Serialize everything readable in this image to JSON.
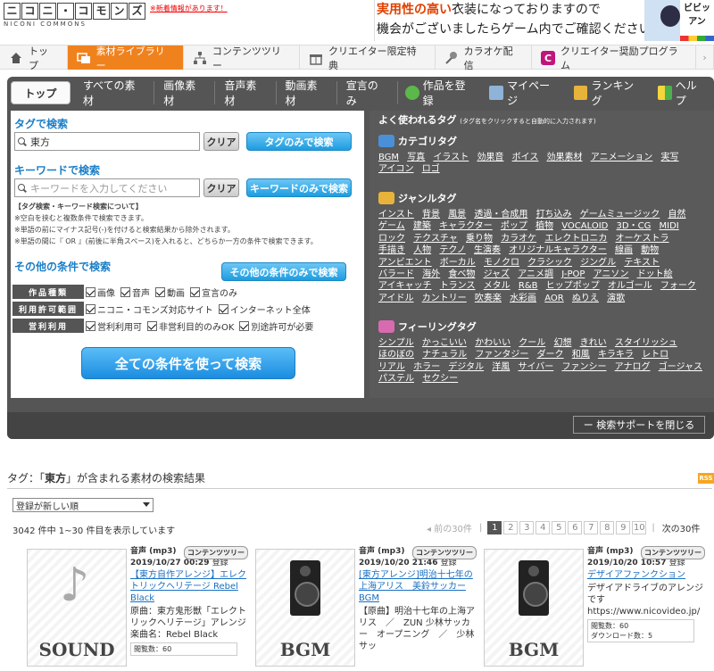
{
  "header": {
    "logo_chars": [
      "ニ",
      "コ",
      "ニ",
      "・",
      "コ",
      "モ",
      "ン",
      "ズ"
    ],
    "logo_sub": "NICONI COMMONS",
    "news": "※新着情報があります！",
    "banner_line1a": "実用性の高い",
    "banner_line1b": "衣装になっておりますので",
    "banner_line2": "機会がございましたらゲーム内でご確認ください。",
    "banner_brand": "ビビッ アン"
  },
  "nav": [
    {
      "label": "トップ",
      "icon": "home-icon"
    },
    {
      "label": "素材ライブラリー",
      "icon": "library-icon"
    },
    {
      "label": "コンテンツツリー",
      "icon": "tree-icon"
    },
    {
      "label": "クリエイター限定特典",
      "icon": "gift-icon"
    },
    {
      "label": "カラオケ配信",
      "icon": "microphone-icon"
    },
    {
      "label": "クリエイター奨励プログラム",
      "icon": "c-icon"
    }
  ],
  "tabs": [
    "すべての素材",
    "画像素材",
    "音声素材",
    "動画素材",
    "宣言のみ"
  ],
  "tab_top": "トップ",
  "tabs_right": [
    "作品を登録",
    "マイページ",
    "ランキング",
    "ヘルプ"
  ],
  "search": {
    "tag_title": "タグで検索",
    "tag_value": "東方",
    "clear": "クリア",
    "tag_only": "タグのみで検索",
    "kw_title": "キーワードで検索",
    "kw_placeholder": "キーワードを入力してください",
    "kw_only": "キーワードのみで検索",
    "note_title": "【タグ検索・キーワード検索について】",
    "note1": "※空白を挟むと複数条件で検索できます。",
    "note2": "※単語の前にマイナス記号(-)を付けると検索結果から除外されます。",
    "note3": "※単語の間に『 OR 』(前後に半角スペース)を入れると、どちらか一方の条件で検索できます。",
    "other_title": "その他の条件で検索",
    "other_only": "その他の条件のみで検索",
    "rows": [
      {
        "label": "作品種類",
        "opts": [
          "画像",
          "音声",
          "動画",
          "宣言のみ"
        ]
      },
      {
        "label": "利用許可範囲",
        "opts": [
          "ニコニ・コモンズ対応サイト",
          "インターネット全体"
        ]
      },
      {
        "label": "営利利用",
        "opts": [
          "営利利用可",
          "非営利目的のみOK",
          "別途許可が必要"
        ]
      }
    ],
    "all_search": "全ての条件を使って検索"
  },
  "tags": {
    "title": "よく使われるタグ",
    "title_note": "(タグ名をクリックすると自動的に入力されます)",
    "cat_head": "カテゴリタグ",
    "cat": [
      "BGM",
      "写真",
      "イラスト",
      "効果音",
      "ボイス",
      "効果素材",
      "アニメーション",
      "実写",
      "アイコン",
      "ロゴ"
    ],
    "genre_head": "ジャンルタグ",
    "genre": [
      "インスト",
      "背景",
      "風景",
      "透過・合成用",
      "打ち込み",
      "ゲームミュージック",
      "自然",
      "ゲーム",
      "建築",
      "キャラクター",
      "ポップ",
      "植物",
      "VOCALOID",
      "3D・CG",
      "MIDI",
      "ロック",
      "テクスチャ",
      "乗り物",
      "カラオケ",
      "エレクトロニカ",
      "オーケストラ",
      "手描き",
      "人物",
      "テクノ",
      "生演奏",
      "オリジナルキャラクター",
      "線画",
      "動物",
      "アンビエント",
      "ボーカル",
      "モノクロ",
      "クラシック",
      "ジングル",
      "テキスト",
      "バラード",
      "海外",
      "食べ物",
      "ジャズ",
      "アニメ調",
      "J-POP",
      "アニソン",
      "ドット絵",
      "アイキャッチ",
      "トランス",
      "メタル",
      "R&B",
      "ヒップポップ",
      "オルゴール",
      "フォーク",
      "アイドル",
      "カントリー",
      "吹奏楽",
      "水彩画",
      "AOR",
      "ぬりえ",
      "演歌"
    ],
    "feel_head": "フィーリングタグ",
    "feel": [
      "シンプル",
      "かっこいい",
      "かわいい",
      "クール",
      "幻想",
      "きれい",
      "スタイリッシュ",
      "ほのぼの",
      "ナチュラル",
      "ファンタジー",
      "ダーク",
      "和風",
      "キラキラ",
      "レトロ",
      "リアル",
      "ホラー",
      "デジタル",
      "洋風",
      "サイバー",
      "ファンシー",
      "アナログ",
      "ゴージャス",
      "パステル",
      "セクシー"
    ]
  },
  "close_support": "ー 検索サポートを閉じる",
  "results": {
    "title_pre": "タグ：「",
    "title_tag": "東方",
    "title_post": "」が含まれる素材の検索結果",
    "rss": "RSS",
    "sort": "登録が新しい順",
    "count": "3042 件中 1~30 件目を表示しています",
    "prev": "◂ 前の30件",
    "pages": [
      "1",
      "2",
      "3",
      "4",
      "5",
      "6",
      "7",
      "8",
      "9",
      "10"
    ],
    "next": "次の30件",
    "cards": [
      {
        "thumb": "SOUND",
        "type": "音声 (mp3)",
        "badge": "コンテンツツリー",
        "date": "2019/10/27 00:29",
        "reg": "登録",
        "title": "【東方自作アレンジ】エレクトリックヘリテージ Rebel Black",
        "desc": "原曲：東方鬼形獣「エレクトリックヘリテージ」アレンジ楽曲名：Rebel Black",
        "stats": "閲覧数：60",
        "dl": ""
      },
      {
        "thumb": "BGM",
        "type": "音声 (mp3)",
        "badge": "コンテンツツリー",
        "date": "2019/10/20 21:46",
        "reg": "登録",
        "title": "[東方アレンジ]明治十七年の上海アリス　美鈴サッカー BGM",
        "desc": "【原曲】明治十七年の上海アリス　／　ZUN 少林サッカー　オープニング　／　少林サッ",
        "stats": "",
        "dl": ""
      },
      {
        "thumb": "BGM",
        "type": "音声 (mp3)",
        "badge": "コンテンツツリー",
        "date": "2019/10/20 10:57",
        "reg": "登録",
        "title": "デザイアファンクション",
        "desc": "デザイアドライブのアレンジです https://www.nicovideo.jp/",
        "stats": "閲覧数：60",
        "dl": "ダウンロード数：5"
      }
    ]
  }
}
